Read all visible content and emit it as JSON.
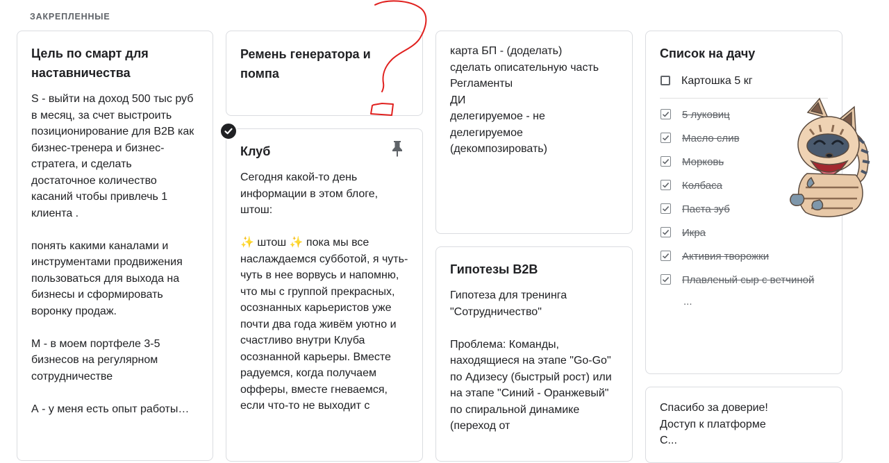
{
  "section": {
    "label": "ЗАКРЕПЛЕННЫЕ"
  },
  "notes": [
    {
      "title": "Цель по смарт для наставничества",
      "body": "S - выйти на доход 500 тыс руб в месяц, за счет выстроить позиционирование для B2B как бизнес-тренера и бизнес-стратега, и сделать достаточное количество касаний чтобы привлечь 1 клиента .\n\nпонять какими каналами и инструментами продвижения пользоваться для выхода на бизнесы и сформировать воронку продаж.\n\nM - в моем портфеле 3-5 бизнесов на регулярном сотрудничестве\n\nА - у меня есть опыт работы…"
    },
    {
      "title": "Ремень генератора и помпа",
      "body": ""
    },
    {
      "title": "Клуб",
      "pinned": true,
      "selected": true,
      "body": "Сегодня какой-то день информации в этом блоге, штош:\n\n✨ штош ✨ пока мы все наслаждаемся субботой, я чуть-чуть в нее ворвусь и напомню, что мы с группой прекрасных, осознанных карьеристов  уже почти два года живём уютно и счастливо внутри Клуба осознанной карьеры. Вместе радуемся, когда получаем офферы, вместе гневаемся, если что-то не выходит с"
    },
    {
      "title": "",
      "body": "карта БП - (доделать)\nсделать описательную часть\nРегламенты\nДИ\nделегируемое - не делегируемое (декомпозировать)"
    },
    {
      "title": "Гипотезы B2B",
      "body": "Гипотеза для тренинга \"Сотрудничество\"\n\nПроблема: Команды, находящиеся на этапе \"Go-Go\" по Адизесу (быстрый рост) или на этапе \"Синий - Оранжевый\" по спиральной динамике (переход от"
    },
    {
      "title": "Список на дачу",
      "unchecked": [
        "Картошка 5 кг"
      ],
      "checked": [
        "5 луковиц",
        "Масло слив",
        "Морковь",
        "Колбаса",
        "Паста зуб",
        "Икра",
        "Активия творожки",
        "Плавленый сыр с ветчиной"
      ],
      "more": "..."
    },
    {
      "title": "",
      "body": "Спасибо за доверие!\nДоступ к платформе\nС..."
    }
  ],
  "icons": {
    "pin": "pin-icon",
    "select": "check-circle-icon",
    "checkbox": "checkbox-icon"
  },
  "colors": {
    "text": "#202124",
    "muted": "#5f6368",
    "border": "#dadce0",
    "annotation": "#e0201e"
  }
}
